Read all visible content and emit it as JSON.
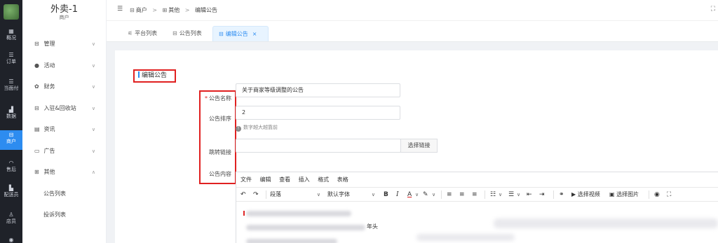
{
  "rail": {
    "items": [
      {
        "label": "概况",
        "icon": "dashboard-icon"
      },
      {
        "label": "订单",
        "icon": "list-icon"
      },
      {
        "label": "当面付",
        "icon": "list-icon"
      },
      {
        "label": "数据",
        "icon": "bar-chart-icon"
      },
      {
        "label": "商户",
        "icon": "store-icon"
      },
      {
        "label": "售后",
        "icon": "headset-icon"
      },
      {
        "label": "配送员",
        "icon": "rider-icon"
      },
      {
        "label": "店员",
        "icon": "user-icon"
      }
    ],
    "active_index": 4
  },
  "sidebar": {
    "title": "外卖-1",
    "subtitle": "商户",
    "items": [
      {
        "label": "管理",
        "icon": "store-icon",
        "chevron": "∨"
      },
      {
        "label": "活动",
        "icon": "activity-icon",
        "chevron": "∨"
      },
      {
        "label": "财务",
        "icon": "finance-icon",
        "chevron": "∨"
      },
      {
        "label": "入驻&回收站",
        "icon": "store-icon",
        "chevron": "∨"
      },
      {
        "label": "资讯",
        "icon": "news-icon",
        "chevron": "∨"
      },
      {
        "label": "广告",
        "icon": "monitor-icon",
        "chevron": "∨"
      },
      {
        "label": "其他",
        "icon": "grid-icon",
        "chevron": "∧"
      }
    ],
    "sub_items": [
      {
        "label": "公告列表"
      },
      {
        "label": "投诉列表"
      }
    ]
  },
  "header": {
    "breadcrumbs": [
      "商户",
      "其他",
      "编辑公告"
    ],
    "separator": ">"
  },
  "tabs": [
    {
      "label": "平台列表",
      "icon": "sliders-icon"
    },
    {
      "label": "公告列表",
      "icon": "store-icon"
    },
    {
      "label": "编辑公告",
      "icon": "store-icon",
      "active": true,
      "close": "×"
    }
  ],
  "form": {
    "section_title": "编辑公告",
    "name_label": "公告名称",
    "name_required_mark": "*",
    "name_value": "关于商家等级调整的公告",
    "order_label": "公告排序",
    "order_value": "2",
    "order_hint": "数字越大越靠前",
    "link_label": "跳转链接",
    "link_value": "",
    "link_button": "选择链接",
    "content_label": "公告内容"
  },
  "editor": {
    "menus": [
      "文件",
      "编辑",
      "查看",
      "插入",
      "格式",
      "表格"
    ],
    "paragraph_select": "段落",
    "font_select": "默认字体",
    "buttons": {
      "bold": "B",
      "italic": "I",
      "font_color": "A",
      "video": "选择视频",
      "image": "选择图片"
    },
    "visible_text_fragment": "年头"
  },
  "colors": {
    "accent": "#2d8cf0",
    "highlight_box": "#e02020",
    "rail_bg": "#1f2229"
  }
}
